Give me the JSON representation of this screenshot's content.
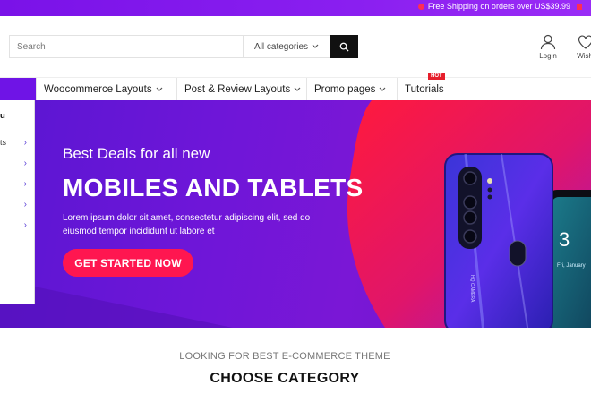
{
  "topbar": {
    "promo_text": "Free Shipping on orders over US$39.99"
  },
  "header": {
    "search_placeholder": "Search",
    "category_select": "All categories",
    "login_label": "Login",
    "wishlist_label": "Wishl"
  },
  "nav": {
    "items": [
      {
        "label": "Woocommerce Layouts"
      },
      {
        "label": "Post & Review Layouts"
      },
      {
        "label": "Promo pages"
      },
      {
        "label": "Tutorials"
      }
    ],
    "hot_badge": "HOT"
  },
  "sidebar": {
    "heading": "u",
    "items": [
      {
        "label": "ts"
      },
      {
        "label": ""
      },
      {
        "label": ""
      },
      {
        "label": ""
      },
      {
        "label": ""
      }
    ]
  },
  "hero": {
    "subtitle": "Best Deals for all new",
    "title": "MOBILES AND TABLETS",
    "description": "Lorem ipsum dolor sit amet, consectetur adipiscing elit, sed do eiusmod tempor incididunt ut labore et",
    "cta_label": "GET STARTED NOW",
    "phone_text": "HQ CAMERA",
    "tablet_time": "3",
    "tablet_date": "Fri, January",
    "colors": {
      "accent": "#ff1650",
      "purple": "#6e16d8"
    }
  },
  "section": {
    "subtitle": "LOOKING FOR BEST E-COMMERCE THEME",
    "title": "CHOOSE CATEGORY"
  }
}
